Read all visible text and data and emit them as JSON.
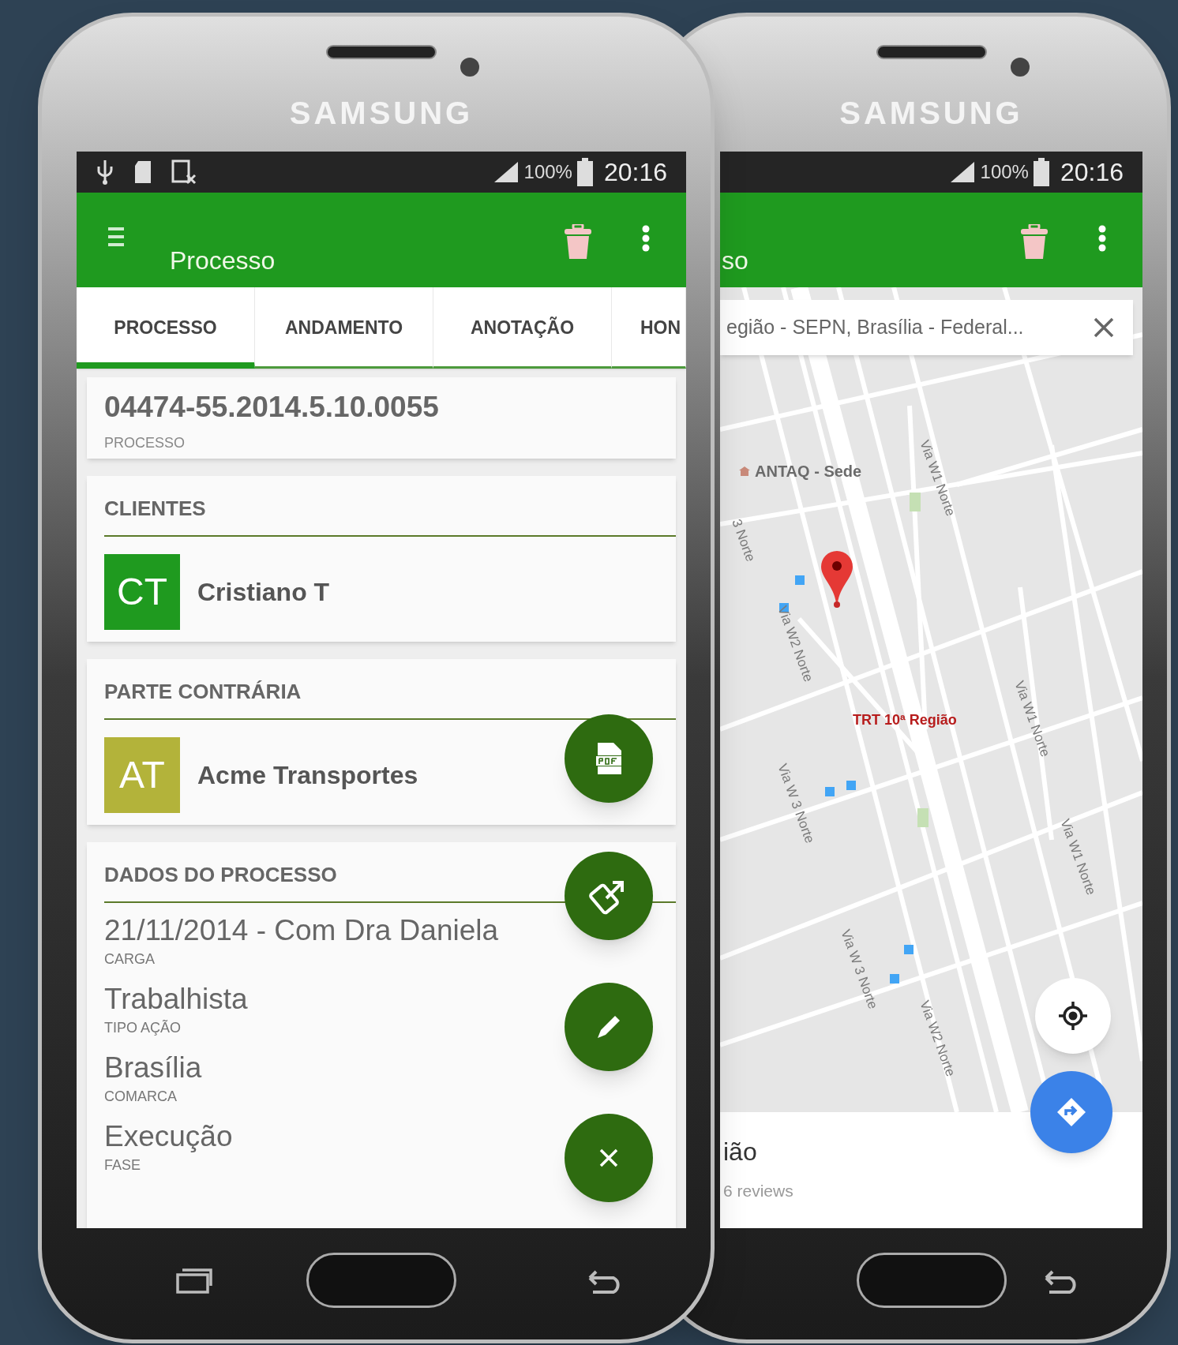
{
  "left_phone": {
    "brand": "SAMSUNG",
    "status_bar": {
      "battery": "100%",
      "time": "20:16"
    },
    "toolbar": {
      "title": "Processo"
    },
    "tabs": [
      {
        "label": "PROCESSO",
        "selected": true
      },
      {
        "label": "ANDAMENTO",
        "selected": false
      },
      {
        "label": "ANOTAÇÃO",
        "selected": false
      },
      {
        "label": "HON",
        "selected": false
      }
    ],
    "process": {
      "number": "04474-55.2014.5.10.0055",
      "label": "PROCESSO"
    },
    "sections": [
      {
        "title": "CLIENTES",
        "people": [
          {
            "initials": "CT",
            "name": "Cristiano T",
            "color": "#1f9a1f"
          }
        ]
      },
      {
        "title": "PARTE CONTRÁRIA",
        "people": [
          {
            "initials": "AT",
            "name": "Acme Transportes",
            "color": "#b3b33a"
          }
        ]
      }
    ],
    "details": {
      "title": "DADOS DO PROCESSO",
      "fields": [
        {
          "value": "21/11/2014 - Com Dra Daniela",
          "label": "CARGA"
        },
        {
          "value": "Trabalhista",
          "label": "TIPO AÇÃO"
        },
        {
          "value": "Brasília",
          "label": "COMARCA"
        },
        {
          "value": "Execução",
          "label": "FASE"
        }
      ]
    },
    "fabs": [
      {
        "kind": "pdf"
      },
      {
        "kind": "share"
      },
      {
        "kind": "edit"
      },
      {
        "kind": "close"
      }
    ]
  },
  "right_phone": {
    "brand": "SAMSUNG",
    "status_bar": {
      "battery": "100%",
      "time": "20:16"
    },
    "toolbar": {
      "title": "so"
    },
    "search": {
      "value": "egião - SEPN, Brasília - Federal..."
    },
    "map_labels": [
      {
        "text": "ANTAQ - Sede",
        "kind": "poi"
      },
      {
        "text": "Via W1 Norte",
        "kind": "street"
      },
      {
        "text": "3 Norte",
        "kind": "street"
      },
      {
        "text": "Via W2 Norte",
        "kind": "street"
      },
      {
        "text": "Via W 3 Norte",
        "kind": "street"
      },
      {
        "text": "Via W1 Norte",
        "kind": "street"
      },
      {
        "text": "Via W1 Norte",
        "kind": "street"
      },
      {
        "text": "Via W 3 Norte",
        "kind": "street"
      },
      {
        "text": "Via W2 Norte",
        "kind": "street"
      },
      {
        "text": "TRT 10ª Região",
        "kind": "pin"
      }
    ],
    "place": {
      "title": "ião",
      "reviews": "6 reviews"
    }
  }
}
